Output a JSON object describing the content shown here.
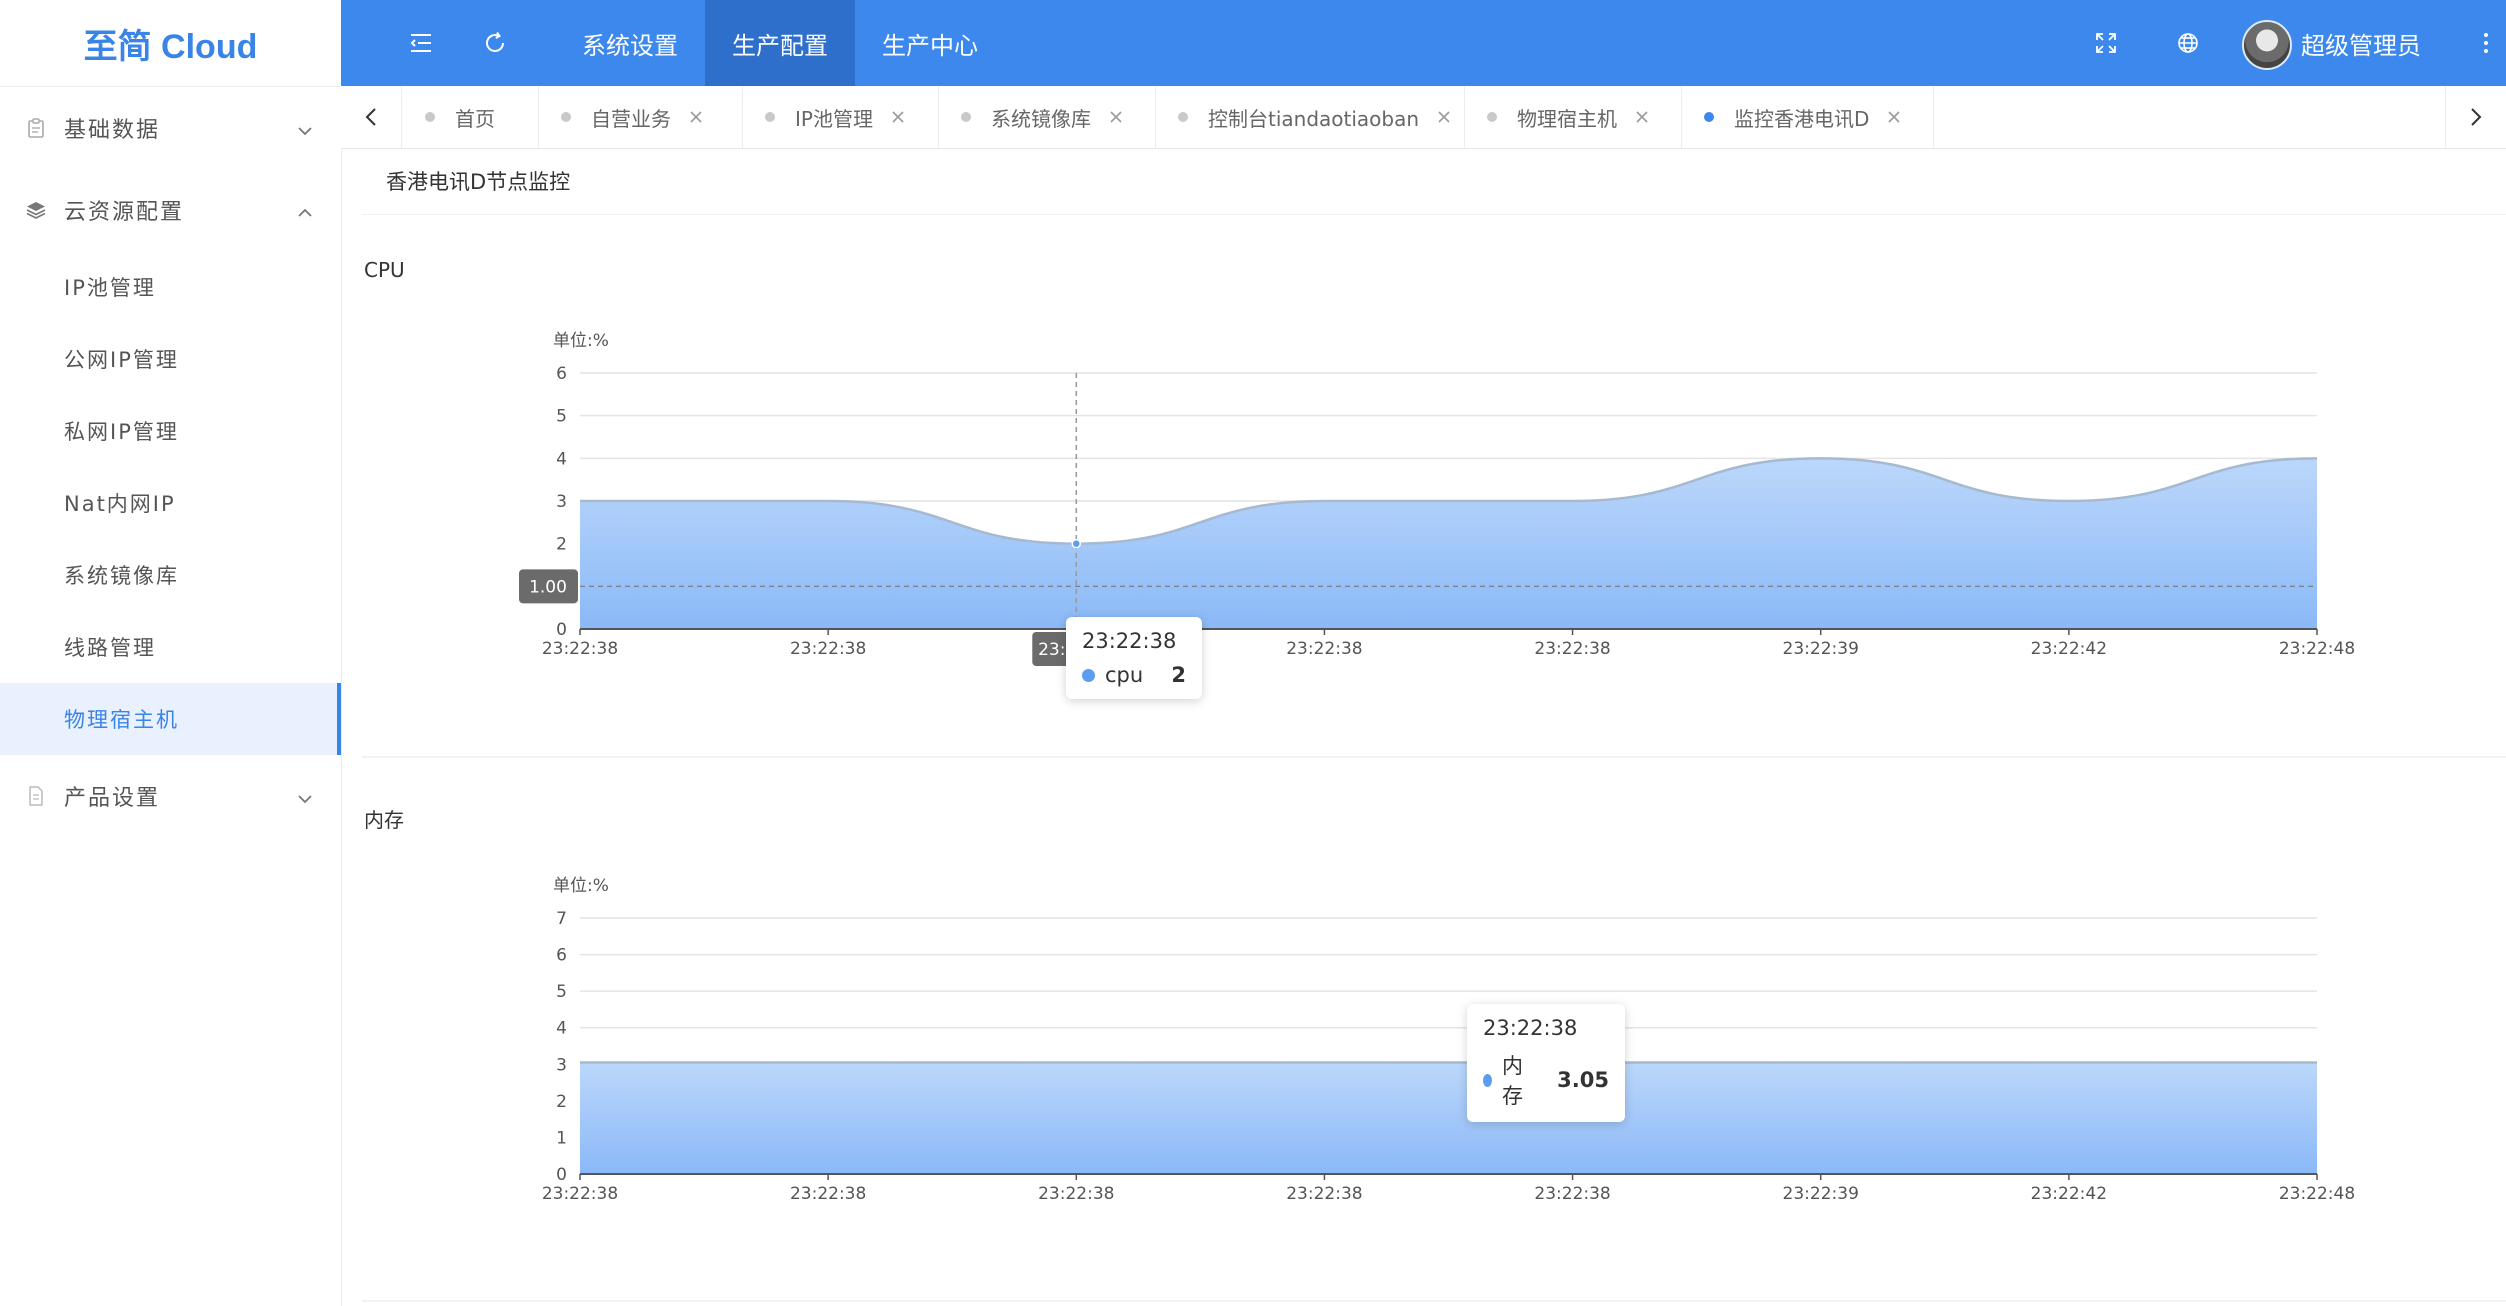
{
  "app": {
    "logo": "至简 Cloud"
  },
  "topbar": {
    "nav": [
      {
        "label": "系统设置"
      },
      {
        "label": "生产配置",
        "active": true
      },
      {
        "label": "生产中心"
      }
    ],
    "username": "超级管理员"
  },
  "sidebar": {
    "groups": [
      {
        "label": "基础数据",
        "icon": "clipboard-icon",
        "expanded": false
      },
      {
        "label": "云资源配置",
        "icon": "layers-icon",
        "expanded": true,
        "items": [
          "IP池管理",
          "公网IP管理",
          "私网IP管理",
          "Nat内网IP",
          "系统镜像库",
          "线路管理",
          "物理宿主机"
        ],
        "active_item": "物理宿主机"
      },
      {
        "label": "产品设置",
        "icon": "document-icon",
        "expanded": false
      }
    ]
  },
  "tabs": [
    {
      "label": "首页",
      "closable": false
    },
    {
      "label": "自营业务",
      "closable": true
    },
    {
      "label": "IP池管理",
      "closable": true
    },
    {
      "label": "系统镜像库",
      "closable": true
    },
    {
      "label": "控制台tiandaotiaoban",
      "closable": true
    },
    {
      "label": "物理宿主机",
      "closable": true
    },
    {
      "label": "监控香港电讯D",
      "closable": true,
      "active": true
    }
  ],
  "page": {
    "title": "香港电讯D节点监控"
  },
  "colors": {
    "primary": "#3c88ec",
    "topbar_active": "#2f6fcc",
    "area_top": "#bcd7fb",
    "area_bottom": "#8ab9f7",
    "line": "#a6b9cf"
  },
  "chart_data": [
    {
      "type": "area",
      "title": "CPU",
      "ylabel": "单位:%",
      "x": [
        "23:22:38",
        "23:22:38",
        "23:22:38",
        "23:22:38",
        "23:22:38",
        "23:22:39",
        "23:22:42",
        "23:22:48"
      ],
      "ylim": [
        0,
        6
      ],
      "yticks": [
        0,
        1,
        2,
        3,
        4,
        5,
        6
      ],
      "smooth": true,
      "series": [
        {
          "name": "cpu",
          "values": [
            3,
            3,
            2,
            3,
            3,
            4,
            3,
            4
          ]
        }
      ],
      "axis_pointer": {
        "y_label": "1.00",
        "x_index": 2,
        "x_label": "23:22:38"
      },
      "tooltip": {
        "time": "23:22:38",
        "series": "cpu",
        "value": "2"
      }
    },
    {
      "type": "area",
      "title": "内存",
      "ylabel": "单位:%",
      "x": [
        "23:22:38",
        "23:22:38",
        "23:22:38",
        "23:22:38",
        "23:22:38",
        "23:22:39",
        "23:22:42",
        "23:22:48"
      ],
      "ylim": [
        0,
        7
      ],
      "yticks": [
        0,
        1,
        2,
        3,
        4,
        5,
        6,
        7
      ],
      "smooth": false,
      "series": [
        {
          "name": "内存",
          "values": [
            3.05,
            3.05,
            3.05,
            3.05,
            3.05,
            3.05,
            3.05,
            3.05
          ]
        }
      ],
      "tooltip": {
        "time": "23:22:38",
        "series": "内存",
        "value": "3.05"
      }
    }
  ]
}
